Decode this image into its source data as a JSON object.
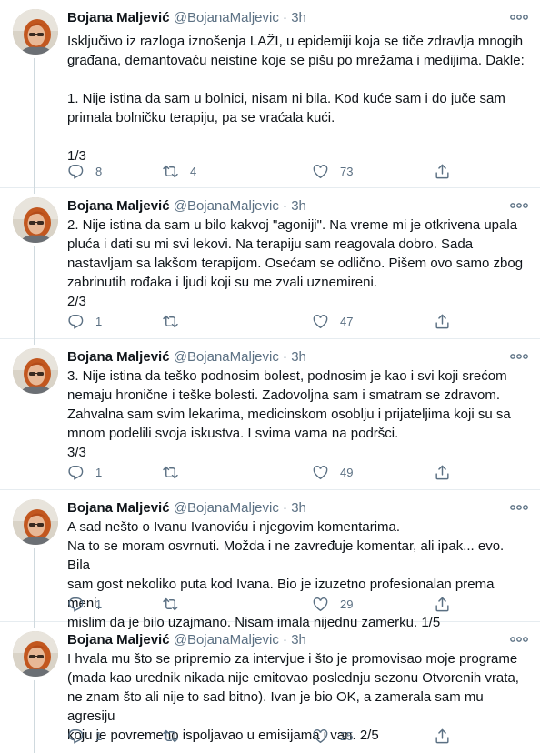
{
  "author": {
    "name": "Bojana Maljević",
    "handle": "@BojanaMaljevic",
    "separator": "·"
  },
  "tweets": [
    {
      "time": "3h",
      "text": "Isključivo iz razloga iznošenja LAŽI, u epidemiji koja se tiče zdravlja mnogih\ngrađana, demantovaću neistine koje se pišu po mrežama i medijima. Dakle:\n\n1. Nije istina da sam u bolnici, nisam ni bila. Kod kuće sam i do juče sam\nprimala bolničku terapiju, pa se vraćala kući.\n\n1/3",
      "replies": "8",
      "retweets": "4",
      "likes": "73"
    },
    {
      "time": "3h",
      "text": "2. Nije istina da sam u bilo kakvoj \"agoniji\". Na vreme mi je otkrivena upala\npluća i dati su mi svi lekovi. Na terapiju sam reagovala dobro. Sada\nnastavljam sa lakšom terapijom. Osećam se odlično. Pišem ovo samo zbog\nzabrinutih rođaka i ljudi koji su me zvali uznemireni.\n2/3",
      "replies": "1",
      "retweets": "",
      "likes": "47"
    },
    {
      "time": "3h",
      "text": "3. Nije istina da teško podnosim bolest, podnosim je kao i svi koji srećom\nnemaju hronične i teške bolesti. Zadovoljna sam i smatram se zdravom.\nZahvalna sam svim lekarima, medicinskom osoblju i prijateljima koji su sa\nmnom podelili svoja iskustva. I svima vama na podršci.\n3/3",
      "replies": "1",
      "retweets": "",
      "likes": "49"
    },
    {
      "time": "3h",
      "text": "A sad nešto o Ivanu Ivanoviću i njegovim komentarima.\nNa to se moram osvrnuti. Možda i ne zavređuje komentar, ali ipak... evo. Bila\nsam gost nekoliko puta kod Ivana. Bio je izuzetno profesionalan prema meni,\nmislim da je bilo uzajmano. Nisam imala nijednu zamerku. 1/5",
      "replies": "1",
      "retweets": "",
      "likes": "29"
    },
    {
      "time": "3h",
      "text": "I hvala mu što se pripremio za intervjue i što je promovisao moje programe\n(mada kao urednik nikada nije emitovao poslednju sezonu Otvorenih vrata,\nne znam što ali nije to sad bitno). Ivan je bio OK, a zamerala sam mu agresiju\nkoju je povremeno ispoljavao u emisijama i van. 2/5",
      "replies": "1",
      "retweets": "",
      "likes": "25"
    }
  ],
  "icons": {
    "reply": "reply-icon",
    "retweet": "retweet-icon",
    "like": "like-icon",
    "share": "share-icon",
    "more": "more-icon"
  },
  "colors": {
    "text": "#0f1419",
    "secondary": "#5b7083",
    "divider": "#e6ecf0",
    "thread_line": "#cfd9de"
  }
}
